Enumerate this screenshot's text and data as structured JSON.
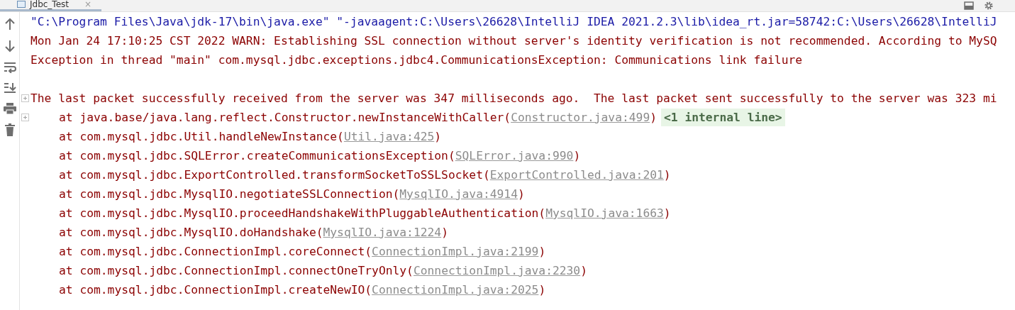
{
  "tab": {
    "label": "Jdbc_Test",
    "close": "×",
    "selected": true
  },
  "toolbar": [
    {
      "kind": "up"
    },
    {
      "kind": "down"
    },
    {
      "kind": "wrap"
    },
    {
      "kind": "scroll-end"
    },
    {
      "kind": "print"
    },
    {
      "kind": "trash"
    }
  ],
  "console": [
    {
      "kind": "command",
      "text": "\"C:\\Program Files\\Java\\jdk-17\\bin\\java.exe\" \"-javaagent:C:\\Users\\26628\\IntelliJ IDEA 2021.2.3\\lib\\idea_rt.jar=58742:C:\\Users\\26628\\IntelliJ"
    },
    {
      "kind": "error",
      "text": "Mon Jan 24 17:10:25 CST 2022 WARN: Establishing SSL connection without server's identity verification is not recommended. According to MySQ"
    },
    {
      "kind": "error",
      "text": "Exception in thread \"main\" com.mysql.jdbc.exceptions.jdbc4.CommunicationsException: Communications link failure"
    },
    {
      "kind": "blank"
    },
    {
      "kind": "error",
      "text": "The last packet successfully received from the server was 347 milliseconds ago.  The last packet sent successfully to the server was 323 mi",
      "foldable": true
    },
    {
      "kind": "frame",
      "text": "at java.base/java.lang.reflect.Constructor.newInstanceWithCaller(",
      "link": "Constructor.java:499",
      "end": ")",
      "badge": "<1 internal line>",
      "foldable": true
    },
    {
      "kind": "frame",
      "text": "at com.mysql.jdbc.Util.handleNewInstance(",
      "link": "Util.java:425",
      "end": ")"
    },
    {
      "kind": "frame",
      "text": "at com.mysql.jdbc.SQLError.createCommunicationsException(",
      "link": "SQLError.java:990",
      "end": ")"
    },
    {
      "kind": "frame",
      "text": "at com.mysql.jdbc.ExportControlled.transformSocketToSSLSocket(",
      "link": "ExportControlled.java:201",
      "end": ")"
    },
    {
      "kind": "frame",
      "text": "at com.mysql.jdbc.MysqlIO.negotiateSSLConnection(",
      "link": "MysqlIO.java:4914",
      "end": ")"
    },
    {
      "kind": "frame",
      "text": "at com.mysql.jdbc.MysqlIO.proceedHandshakeWithPluggableAuthentication(",
      "link": "MysqlIO.java:1663",
      "end": ")"
    },
    {
      "kind": "frame",
      "text": "at com.mysql.jdbc.MysqlIO.doHandshake(",
      "link": "MysqlIO.java:1224",
      "end": ")"
    },
    {
      "kind": "frame",
      "text": "at com.mysql.jdbc.ConnectionImpl.coreConnect(",
      "link": "ConnectionImpl.java:2199",
      "end": ")"
    },
    {
      "kind": "frame",
      "text": "at com.mysql.jdbc.ConnectionImpl.connectOneTryOnly(",
      "link": "ConnectionImpl.java:2230",
      "end": ")"
    },
    {
      "kind": "frame",
      "text": "at com.mysql.jdbc.ConnectionImpl.createNewIO(",
      "link": "ConnectionImpl.java:2025",
      "end": ")"
    }
  ]
}
